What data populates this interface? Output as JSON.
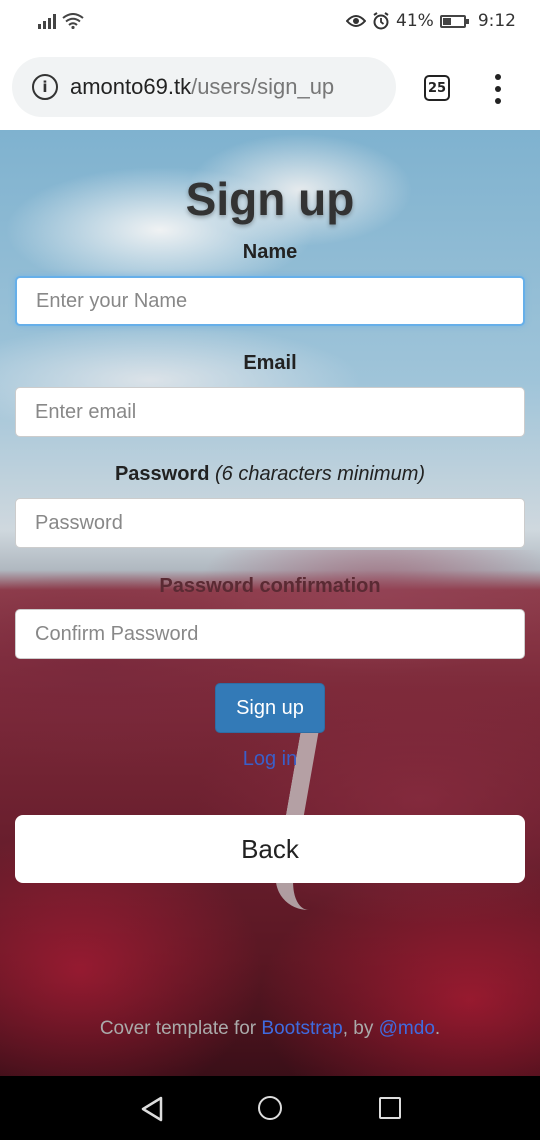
{
  "status_bar": {
    "battery_percent": "41%",
    "battery_level": 0.41,
    "time": "9:12",
    "icons": [
      "signal-icon",
      "wifi-icon",
      "eye-icon",
      "alarm-icon",
      "battery-icon"
    ]
  },
  "browser": {
    "url_host": "amonto69.tk",
    "url_path": "/users/sign_up",
    "tab_count": "25",
    "icons": [
      "info-icon",
      "tab-switcher-icon",
      "more-menu-icon"
    ]
  },
  "form": {
    "title": "Sign up",
    "name_label": "Name",
    "name_placeholder": "Enter your Name",
    "email_label": "Email",
    "email_placeholder": "Enter email",
    "password_label": "Password",
    "password_hint": "(6 characters minimum)",
    "password_placeholder": "Password",
    "confirm_label": "Password confirmation",
    "confirm_placeholder": "Confirm Password",
    "submit_label": "Sign up",
    "login_link": "Log in",
    "back_label": "Back"
  },
  "footer": {
    "prefix": "Cover template for ",
    "bootstrap_link": "Bootstrap",
    "by": ", by ",
    "author_link": "@mdo",
    "suffix": "."
  },
  "navbar": {
    "icons": [
      "back-icon",
      "home-icon",
      "recent-apps-icon"
    ]
  },
  "colors": {
    "primary_button": "#337ab7",
    "link": "#3a5fc9",
    "focus_border": "#66afe9"
  }
}
